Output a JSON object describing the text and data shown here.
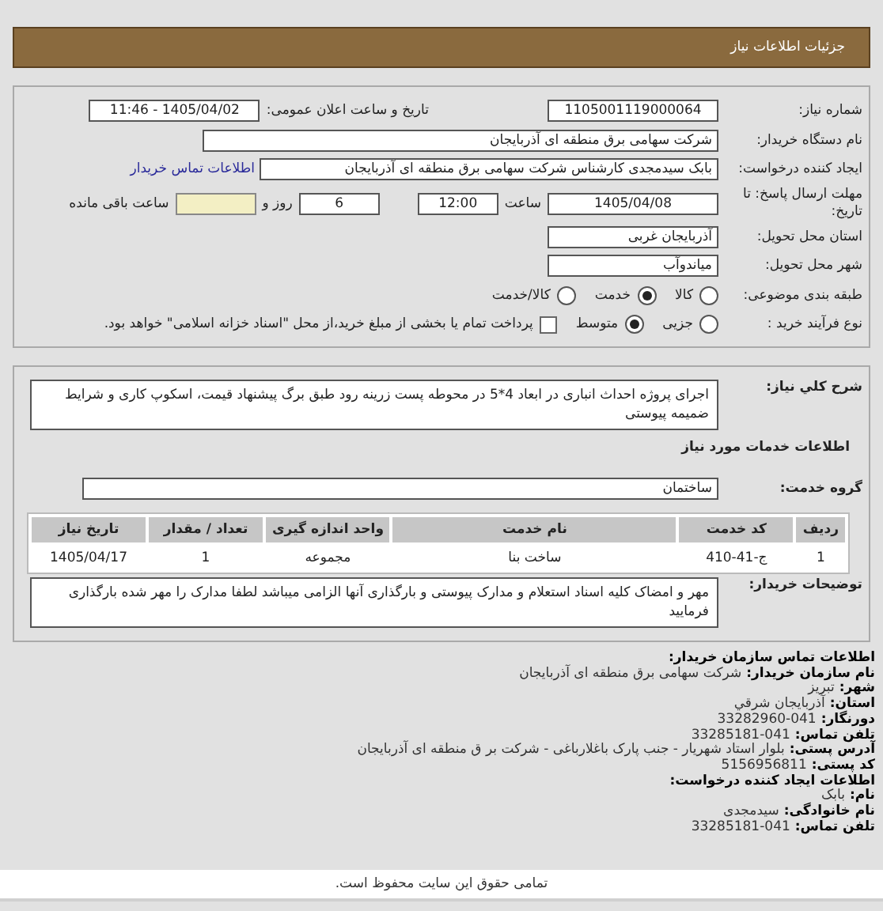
{
  "header": {
    "title": "جزئیات اطلاعات نیاز"
  },
  "need": {
    "number": {
      "label": "شماره نیاز:",
      "value": "1105001119000064"
    },
    "announce": {
      "label": "تاریخ و ساعت اعلان عمومی:",
      "value": "1405/04/02 - 11:46"
    },
    "buyer": {
      "label": "نام دستگاه خریدار:",
      "value": "شرکت سهامی برق منطقه ای آذربایجان"
    },
    "creator": {
      "label": "ایجاد کننده درخواست:",
      "value": "بابک سیدمجدی کارشناس شرکت سهامی برق منطقه ای آذربایجان",
      "link": "اطلاعات تماس خریدار"
    },
    "deadline": {
      "label": "مهلت ارسال پاسخ: تا تاریخ:",
      "date": "1405/04/08",
      "time_label": "ساعت",
      "time": "12:00",
      "days": "6",
      "days_label": "روز و",
      "remaining_label": "ساعت باقی مانده"
    },
    "province": {
      "label": "استان محل تحویل:",
      "value": "آذربایجان غربی"
    },
    "city": {
      "label": "شهر محل تحویل:",
      "value": "میاندوآب"
    },
    "category": {
      "label": "طبقه بندی موضوعی:",
      "options": [
        {
          "label": "کالا",
          "selected": false
        },
        {
          "label": "خدمت",
          "selected": true
        },
        {
          "label": "کالا/خدمت",
          "selected": false
        }
      ]
    },
    "process": {
      "label": "نوع فرآیند خرید :",
      "options": [
        {
          "label": "جزیی",
          "selected": false
        },
        {
          "label": "متوسط",
          "selected": true
        }
      ],
      "payment": {
        "label": "پرداخت تمام یا بخشی از مبلغ خرید،از محل \"اسناد خزانه اسلامی\" خواهد بود.",
        "checked": false
      }
    }
  },
  "details": {
    "description": {
      "label": "شرح کلي نیاز:",
      "value": "اجرای پروژه احداث انباری در ابعاد 4*5 در محوطه پست زرینه رود طبق برگ پیشنهاد قیمت، اسکوپ کاری و شرایط ضمیمه پیوستی"
    },
    "section_title": "اطلاعات خدمات مورد نیاز",
    "service_group": {
      "label": "گروه خدمت:",
      "value": "ساختمان"
    },
    "table": {
      "columns": [
        "ردیف",
        "کد خدمت",
        "نام خدمت",
        "واحد اندازه گیری",
        "تعداد / مقدار",
        "تاریخ نیاز"
      ],
      "rows": [
        [
          "1",
          "ج-41-410",
          "ساخت بنا",
          "مجموعه",
          "1",
          "1405/04/17"
        ]
      ]
    },
    "notes": {
      "label": "توضیحات خریدار:",
      "value": "مهر و امضاک کلیه اسناد استعلام و مدارک پیوستی و بارگذاری آنها الزامی میباشد لطفا مدارک را مهر شده بارگذاری فرمایید"
    }
  },
  "contact": [
    {
      "kind": "heading",
      "label": "اطلاعات تماس سازمان خریدار:"
    },
    {
      "kind": "field",
      "label": "نام سازمان خریدار:",
      "value": "شرکت سهامی برق منطقه ای آذربایجان"
    },
    {
      "kind": "field",
      "label": "شهر:",
      "value": "تبریز"
    },
    {
      "kind": "field",
      "label": "استان:",
      "value": "آذربایجان شرقي"
    },
    {
      "kind": "field",
      "label": "دورنگار:",
      "value": "041-33282960"
    },
    {
      "kind": "field",
      "label": "تلفن تماس:",
      "value": "041-33285181"
    },
    {
      "kind": "field",
      "label": "آدرس پستی:",
      "value": "بلوار استاد شهریار - جنب پارک باغلارباغی - شرکت بر ق منطقه ای آذربایجان"
    },
    {
      "kind": "field",
      "label": "کد پستی:",
      "value": "5156956811"
    },
    {
      "kind": "heading",
      "label": "اطلاعات ایجاد کننده درخواست:"
    },
    {
      "kind": "field",
      "label": "نام:",
      "value": "بابک"
    },
    {
      "kind": "field",
      "label": "نام خانوادگی:",
      "value": "سیدمجدی"
    },
    {
      "kind": "field",
      "label": "تلفن تماس:",
      "value": "041-33285181"
    }
  ],
  "footer": {
    "text": "تمامی حقوق این سایت محفوظ است."
  }
}
